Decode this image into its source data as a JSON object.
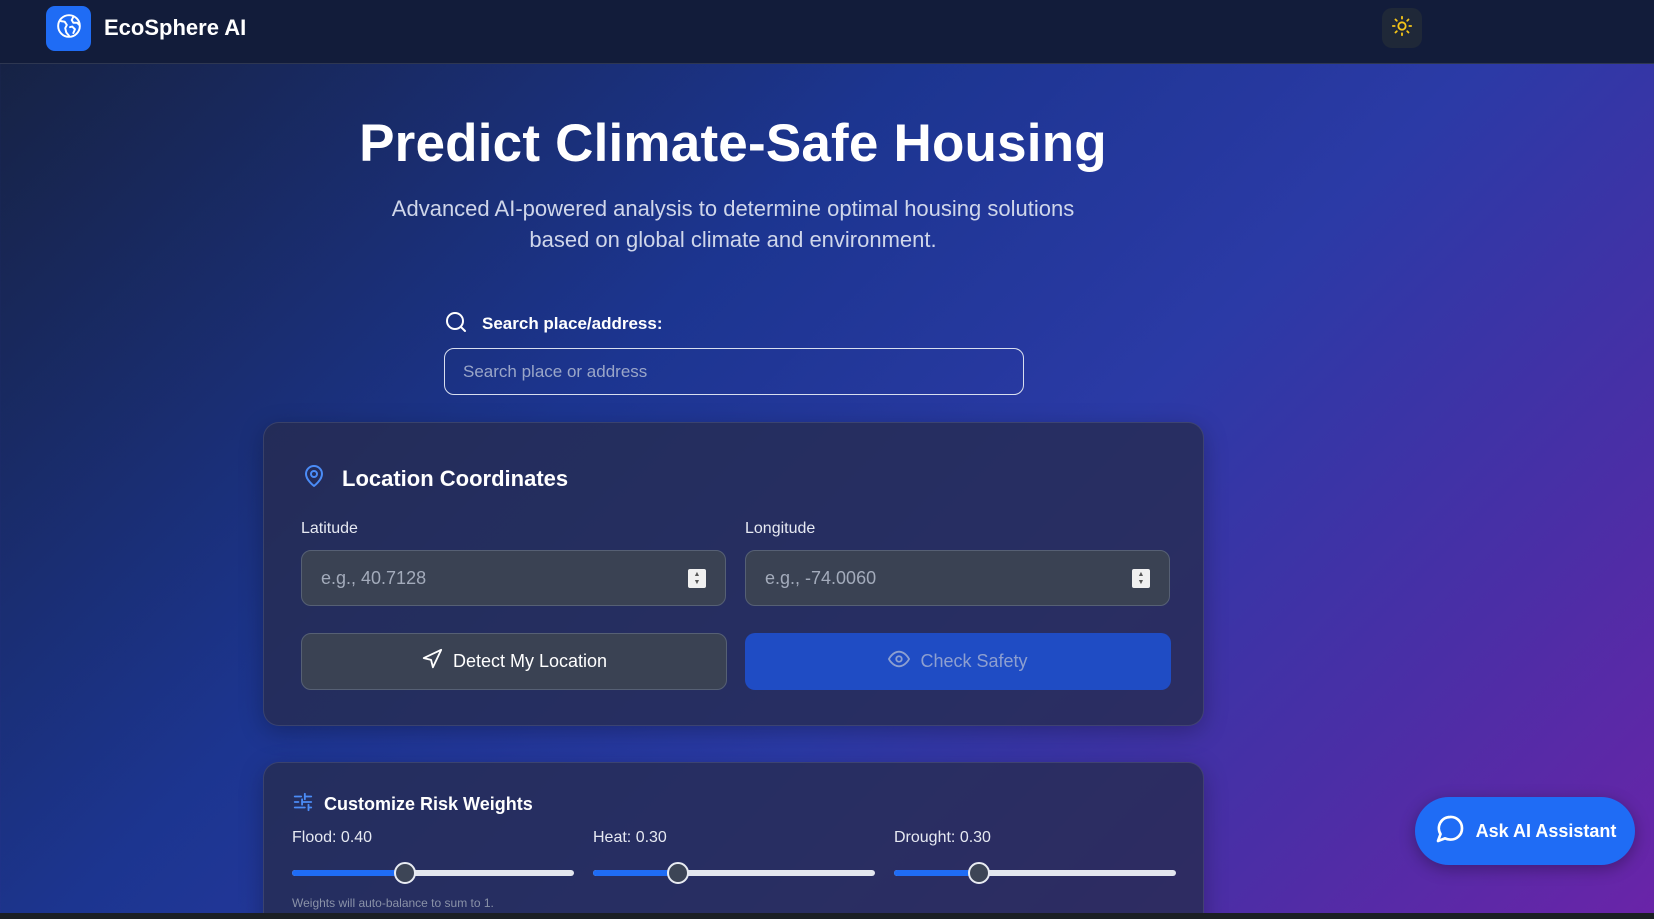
{
  "navbar": {
    "brand": "EcoSphere AI",
    "logo_icon": "globe-icon",
    "theme_toggle_icon": "sun-icon",
    "theme_accent": "#f5c518"
  },
  "hero": {
    "title": "Predict Climate-Safe Housing",
    "subtitle": "Advanced AI-powered analysis to determine optimal housing solutions based on global climate and environment."
  },
  "search": {
    "label": "Search place/address:",
    "placeholder": "Search place or address",
    "value": "",
    "icon": "search-icon"
  },
  "coordinates": {
    "title": "Location Coordinates",
    "icon": "map-pin-icon",
    "latitude": {
      "label": "Latitude",
      "placeholder": "e.g., 40.7128",
      "value": ""
    },
    "longitude": {
      "label": "Longitude",
      "placeholder": "e.g., -74.0060",
      "value": ""
    },
    "detect_button": {
      "label": "Detect My Location",
      "icon": "navigation-arrow-icon"
    },
    "check_button": {
      "label": "Check Safety",
      "icon": "eye-icon",
      "disabled": true
    }
  },
  "weights": {
    "title": "Customize Risk Weights",
    "icon": "sliders-icon",
    "sliders": [
      {
        "label": "Flood: 0.40",
        "value": 0.4
      },
      {
        "label": "Heat: 0.30",
        "value": 0.3
      },
      {
        "label": "Drought: 0.30",
        "value": 0.3
      }
    ],
    "note": "Weights will auto-balance to sum to 1."
  },
  "assistant": {
    "label": "Ask AI Assistant",
    "icon": "chat-bubble-icon"
  },
  "colors": {
    "accent": "#1f6cf5",
    "check_button_bg": "#1f4cc4",
    "pin_icon": "#4b8cf7"
  }
}
